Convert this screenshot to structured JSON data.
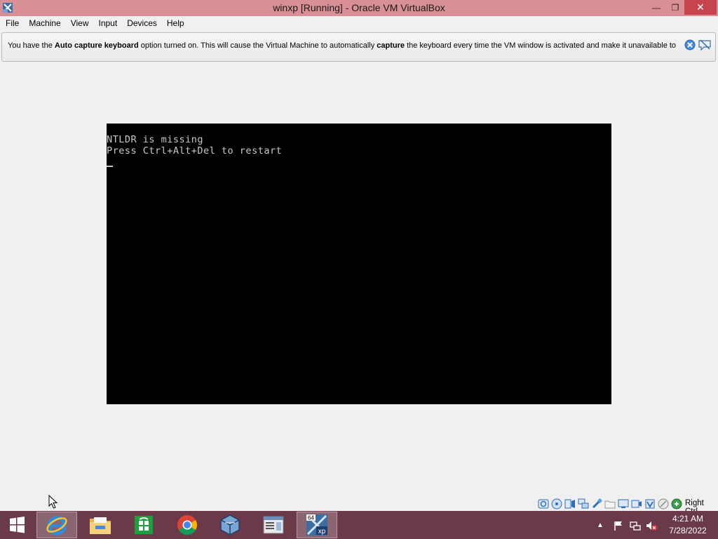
{
  "window": {
    "title": "winxp  [Running] - Oracle VM VirtualBox",
    "minimize_glyph": "—",
    "restore_glyph": "❐",
    "close_glyph": "✕"
  },
  "menubar": {
    "items": [
      {
        "label": "File"
      },
      {
        "label": "Machine"
      },
      {
        "label": "View"
      },
      {
        "label": "Input"
      },
      {
        "label": "Devices"
      },
      {
        "label": "Help"
      }
    ]
  },
  "notice": {
    "text_1": "You have the ",
    "bold_1": "Auto capture keyboard",
    "text_2": " option turned on. This will cause the Virtual Machine to automatically ",
    "bold_2": "capture",
    "text_3": " the keyboard every time the VM window is activated and make it unavailable to"
  },
  "console": {
    "line1": "NTLDR is missing",
    "line2": "Press Ctrl+Alt+Del to restart"
  },
  "statusbar": {
    "icons": [
      "hard-disk-icon",
      "optical-drive-icon",
      "audio-icon",
      "network-icon",
      "usb-icon",
      "shared-folders-icon",
      "display-icon",
      "video-capture-icon",
      "cpu-icon",
      "mouse-integration-icon",
      "host-key-icon"
    ],
    "host_key_label": "Right Ctrl"
  },
  "taskbar": {
    "apps": [
      "internet-explorer-icon",
      "file-explorer-icon",
      "store-icon",
      "chrome-icon",
      "virtualbox-icon",
      "document-app-icon",
      "winxp-vm-icon"
    ],
    "active_app": "winxp-vm-icon",
    "clock_time": "4:21 AM",
    "clock_date": "7/28/2022",
    "tray_up_glyph": "▲",
    "vm_badge_top": "64",
    "vm_badge_bottom": "xp"
  },
  "colors": {
    "titlebar": "#d98f96",
    "close": "#c7434e",
    "taskbar": "#6b3a48",
    "vm_screen": "#000000",
    "console_text": "#c8c8c8"
  }
}
